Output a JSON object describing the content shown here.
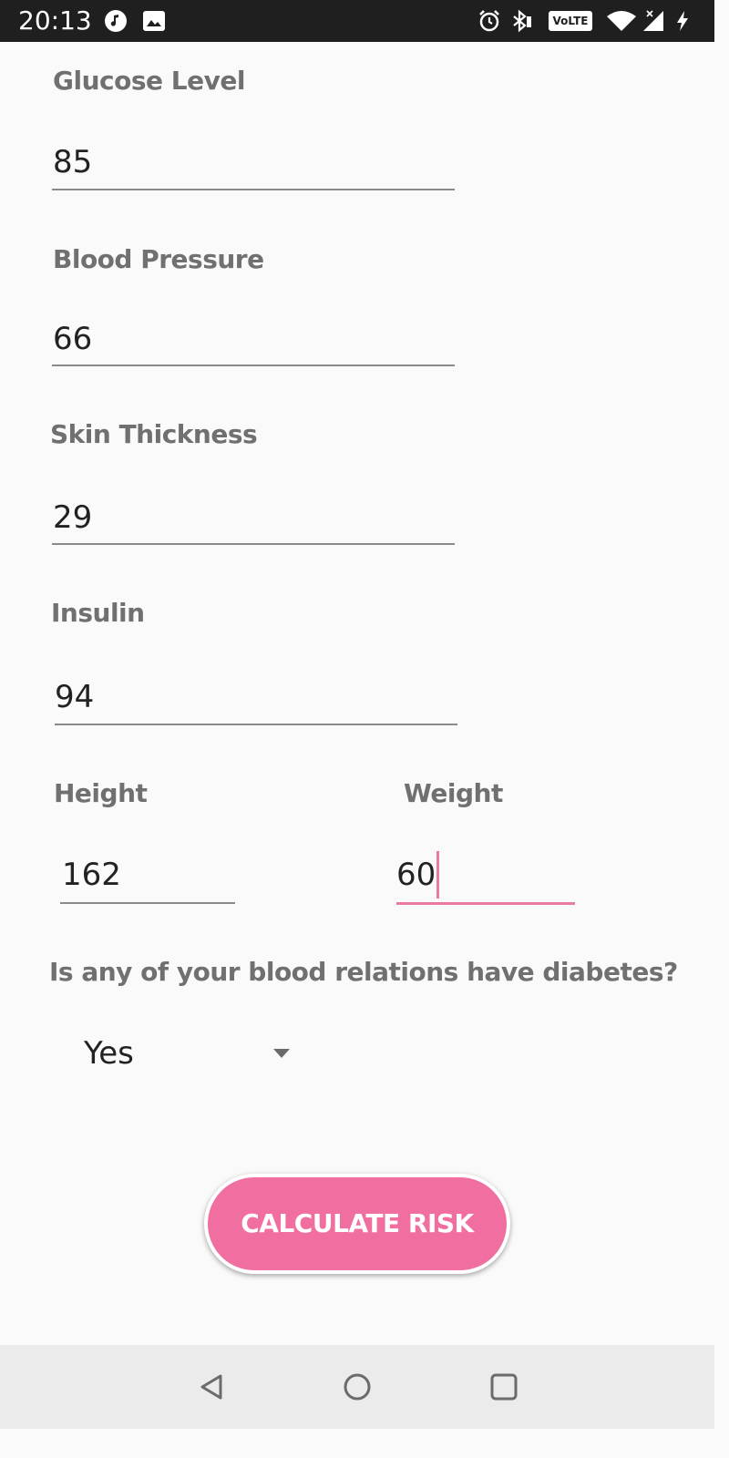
{
  "status_bar": {
    "time": "20:13",
    "icons": [
      "music-note-icon",
      "image-icon",
      "alarm-icon",
      "bluetooth-icon",
      "volte-icon",
      "wifi-icon",
      "signal-icon",
      "charging-icon"
    ],
    "volte_label": "VoLTE"
  },
  "form": {
    "glucose": {
      "label": "Glucose Level",
      "value": "85"
    },
    "blood_pressure": {
      "label": "Blood Pressure",
      "value": "66"
    },
    "skin_thickness": {
      "label": "Skin Thickness",
      "value": "29"
    },
    "insulin": {
      "label": "Insulin",
      "value": "94"
    },
    "height": {
      "label": "Height",
      "value": "162"
    },
    "weight": {
      "label": "Weight",
      "value": "60"
    },
    "family_history": {
      "question": "Is any of your blood relations have diabetes?",
      "selected": "Yes"
    }
  },
  "calculate_button": {
    "label": "CALCULATE RISK"
  },
  "colors": {
    "accent": "#f06ea0",
    "label_gray": "#707070",
    "status_bar": "#1f1f1f",
    "nav_bar": "#ebebeb"
  },
  "nav_bar": {
    "buttons": [
      "back-icon",
      "home-icon",
      "recents-icon"
    ]
  }
}
